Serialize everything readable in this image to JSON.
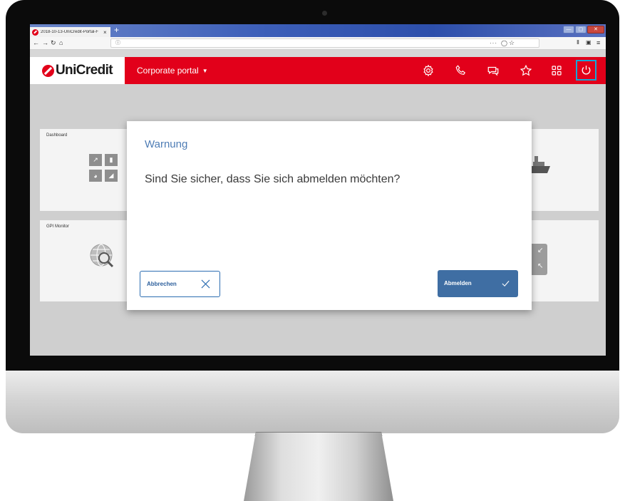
{
  "browser": {
    "tab_title": "2018-10-13-UniCredit-Portal-F",
    "tab_close": "×",
    "new_tab": "+",
    "back_icon": "back-arrow-icon",
    "forward_icon": "forward-arrow-icon",
    "reload_icon": "reload-icon",
    "home_icon": "home-icon",
    "address_info_icon": "info-icon",
    "page_menu": "···",
    "window_controls": [
      "—",
      "▢",
      "✕"
    ]
  },
  "header": {
    "logo_text": "UniCredit",
    "portal_label": "Corporate portal",
    "portal_caret": "▼",
    "icons": [
      "gear-icon",
      "phone-icon",
      "chat-icon",
      "star-icon",
      "grid-icon",
      "logout-icon"
    ],
    "brand_color": "#e2001a",
    "highlight_color": "#14a7d8"
  },
  "cards": {
    "dashboard_title": "Dashboard",
    "gpi_title": "GPI Monitor"
  },
  "dialog": {
    "title": "Warnung",
    "message": "Sind Sie sicher, dass Sie sich abmelden möchten?",
    "cancel_label": "Abbrechen",
    "confirm_label": "Abmelden",
    "accent_color": "#3f6ea3"
  }
}
